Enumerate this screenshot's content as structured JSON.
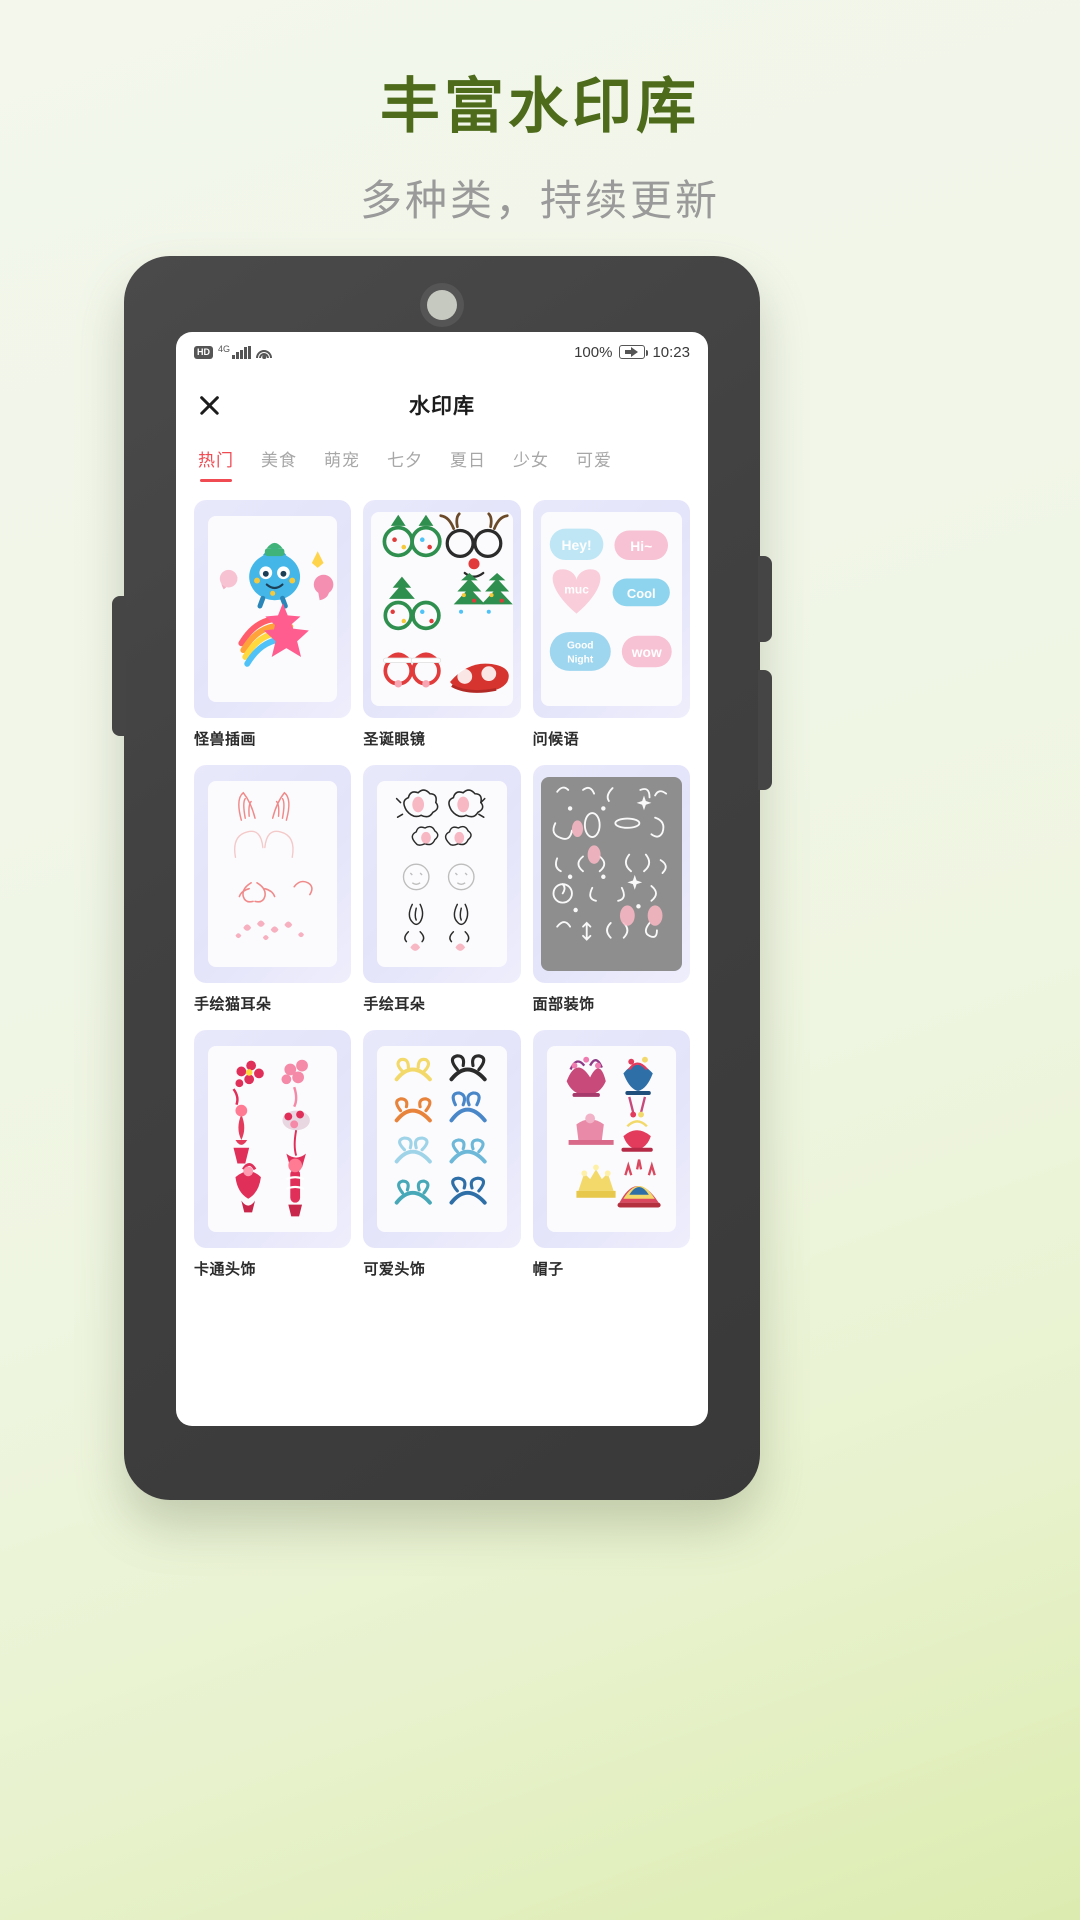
{
  "promo": {
    "title": "丰富水印库",
    "subtitle": "多种类，持续更新",
    "title_color": "#4d6b1b",
    "subtitle_color": "#9a9a9a"
  },
  "status_bar": {
    "hd_label": "HD",
    "network_label": "4G",
    "signal_icon": "signal-bars-icon",
    "wifi_icon": "wifi-icon",
    "battery_percent": "100%",
    "battery_icon": "battery-charging-icon",
    "time": "10:23"
  },
  "app_bar": {
    "close_icon": "close-icon",
    "title": "水印库"
  },
  "tabs": [
    {
      "label": "热门",
      "active": true
    },
    {
      "label": "美食",
      "active": false
    },
    {
      "label": "萌宠",
      "active": false
    },
    {
      "label": "七夕",
      "active": false
    },
    {
      "label": "夏日",
      "active": false
    },
    {
      "label": "少女",
      "active": false
    },
    {
      "label": "可爱",
      "active": false
    }
  ],
  "accent_color": "#f04a52",
  "cards": [
    {
      "label": "怪兽插画",
      "art": "monster"
    },
    {
      "label": "圣诞眼镜",
      "art": "xmas-glasses"
    },
    {
      "label": "问候语",
      "art": "greetings"
    },
    {
      "label": "手绘猫耳朵",
      "art": "cat-ears"
    },
    {
      "label": "手绘耳朵",
      "art": "hand-ears"
    },
    {
      "label": "面部装饰",
      "art": "face-deco"
    },
    {
      "label": "卡通头饰",
      "art": "cartoon-headwear"
    },
    {
      "label": "可爱头饰",
      "art": "cute-headbands"
    },
    {
      "label": "帽子",
      "art": "hats"
    }
  ],
  "greeting_stickers": [
    "Hey!",
    "Hi~",
    "muc",
    "Cool",
    "Good Night",
    "wow"
  ]
}
